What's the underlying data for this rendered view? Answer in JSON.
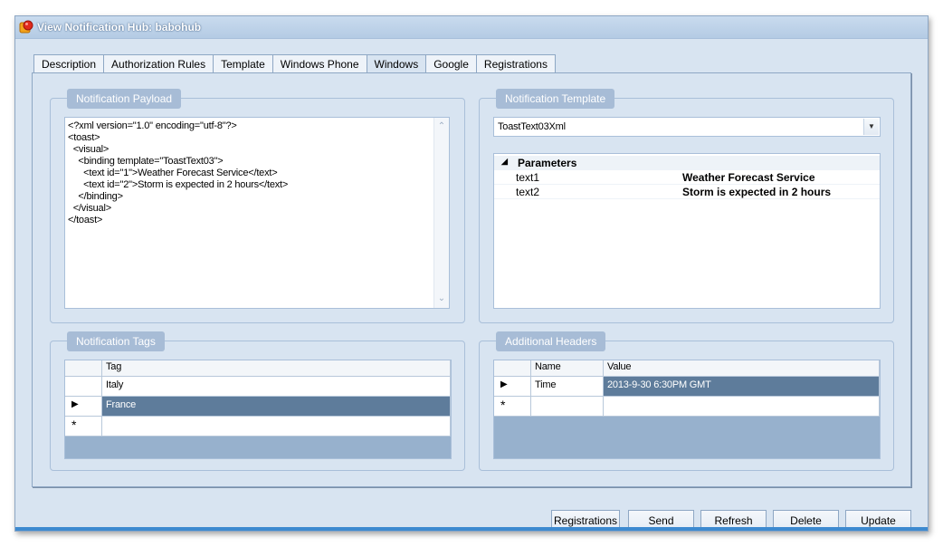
{
  "window": {
    "title": "View Notification Hub: babohub"
  },
  "tabs": [
    "Description",
    "Authorization Rules",
    "Template",
    "Windows Phone",
    "Windows",
    "Google",
    "Registrations"
  ],
  "active_tab": "Windows",
  "payload": {
    "title": "Notification Payload",
    "xml": "<?xml version=\"1.0\" encoding=\"utf-8\"?>\n<toast>\n  <visual>\n    <binding template=\"ToastText03\">\n      <text id=\"1\">Weather Forecast Service</text>\n      <text id=\"2\">Storm is expected in 2 hours</text>\n    </binding>\n  </visual>\n</toast>"
  },
  "template": {
    "title": "Notification Template",
    "selected": "ToastText03Xml",
    "category": "Parameters",
    "params": [
      {
        "key": "text1",
        "value": "Weather Forecast Service"
      },
      {
        "key": "text2",
        "value": "Storm is expected in 2 hours"
      }
    ]
  },
  "tags": {
    "title": "Notification Tags",
    "column": "Tag",
    "rows": [
      "Italy",
      "France"
    ],
    "selected_row": 1,
    "new_row_marker": "*"
  },
  "headers": {
    "title": "Additional Headers",
    "columns": [
      "Name",
      "Value"
    ],
    "rows": [
      {
        "name": "Time",
        "value": "2013-9-30 6:30PM GMT"
      }
    ],
    "new_row_marker": "*"
  },
  "buttons": {
    "registrations": "Registrations",
    "send": "Send",
    "refresh": "Refresh",
    "delete": "Delete",
    "update": "Update"
  },
  "colors": {
    "window_bg": "#d8e4f1",
    "group_title_bg": "#a7bcd6",
    "selection": "#5e7c9b",
    "accent_strip": "#3d8ad0"
  }
}
